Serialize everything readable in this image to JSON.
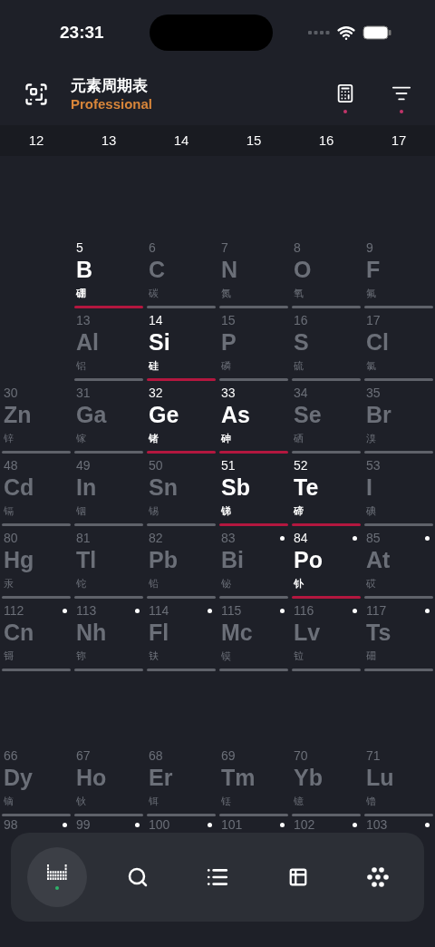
{
  "status_bar": {
    "time": "23:31"
  },
  "header": {
    "title": "元素周期表",
    "subtitle": "Professional"
  },
  "groups": [
    "12",
    "13",
    "14",
    "15",
    "16",
    "17"
  ],
  "rows": [
    {
      "cells": [
        {
          "kind": "empty"
        },
        {
          "kind": "element",
          "number": "5",
          "symbol": "B",
          "name": "硼",
          "highlighted": true,
          "radioactive": false
        },
        {
          "kind": "element",
          "number": "6",
          "symbol": "C",
          "name": "碳",
          "highlighted": false,
          "radioactive": false
        },
        {
          "kind": "element",
          "number": "7",
          "symbol": "N",
          "name": "氮",
          "highlighted": false,
          "radioactive": false
        },
        {
          "kind": "element",
          "number": "8",
          "symbol": "O",
          "name": "氧",
          "highlighted": false,
          "radioactive": false
        },
        {
          "kind": "element",
          "number": "9",
          "symbol": "F",
          "name": "氟",
          "highlighted": false,
          "radioactive": false
        }
      ]
    },
    {
      "cells": [
        {
          "kind": "empty"
        },
        {
          "kind": "element",
          "number": "13",
          "symbol": "Al",
          "name": "铝",
          "highlighted": false,
          "radioactive": false
        },
        {
          "kind": "element",
          "number": "14",
          "symbol": "Si",
          "name": "硅",
          "highlighted": true,
          "radioactive": false
        },
        {
          "kind": "element",
          "number": "15",
          "symbol": "P",
          "name": "磷",
          "highlighted": false,
          "radioactive": false
        },
        {
          "kind": "element",
          "number": "16",
          "symbol": "S",
          "name": "硫",
          "highlighted": false,
          "radioactive": false
        },
        {
          "kind": "element",
          "number": "17",
          "symbol": "Cl",
          "name": "氯",
          "highlighted": false,
          "radioactive": false
        }
      ]
    },
    {
      "cells": [
        {
          "kind": "element",
          "number": "30",
          "symbol": "Zn",
          "name": "锌",
          "highlighted": false,
          "radioactive": false
        },
        {
          "kind": "element",
          "number": "31",
          "symbol": "Ga",
          "name": "镓",
          "highlighted": false,
          "radioactive": false
        },
        {
          "kind": "element",
          "number": "32",
          "symbol": "Ge",
          "name": "锗",
          "highlighted": true,
          "radioactive": false
        },
        {
          "kind": "element",
          "number": "33",
          "symbol": "As",
          "name": "砷",
          "highlighted": true,
          "radioactive": false
        },
        {
          "kind": "element",
          "number": "34",
          "symbol": "Se",
          "name": "硒",
          "highlighted": false,
          "radioactive": false
        },
        {
          "kind": "element",
          "number": "35",
          "symbol": "Br",
          "name": "溴",
          "highlighted": false,
          "radioactive": false
        }
      ]
    },
    {
      "cells": [
        {
          "kind": "element",
          "number": "48",
          "symbol": "Cd",
          "name": "镉",
          "highlighted": false,
          "radioactive": false
        },
        {
          "kind": "element",
          "number": "49",
          "symbol": "In",
          "name": "铟",
          "highlighted": false,
          "radioactive": false
        },
        {
          "kind": "element",
          "number": "50",
          "symbol": "Sn",
          "name": "锡",
          "highlighted": false,
          "radioactive": false
        },
        {
          "kind": "element",
          "number": "51",
          "symbol": "Sb",
          "name": "锑",
          "highlighted": true,
          "radioactive": false
        },
        {
          "kind": "element",
          "number": "52",
          "symbol": "Te",
          "name": "碲",
          "highlighted": true,
          "radioactive": false
        },
        {
          "kind": "element",
          "number": "53",
          "symbol": "I",
          "name": "碘",
          "highlighted": false,
          "radioactive": false
        }
      ]
    },
    {
      "cells": [
        {
          "kind": "element",
          "number": "80",
          "symbol": "Hg",
          "name": "汞",
          "highlighted": false,
          "radioactive": false
        },
        {
          "kind": "element",
          "number": "81",
          "symbol": "Tl",
          "name": "铊",
          "highlighted": false,
          "radioactive": false
        },
        {
          "kind": "element",
          "number": "82",
          "symbol": "Pb",
          "name": "铅",
          "highlighted": false,
          "radioactive": false
        },
        {
          "kind": "element",
          "number": "83",
          "symbol": "Bi",
          "name": "铋",
          "highlighted": false,
          "radioactive": true
        },
        {
          "kind": "element",
          "number": "84",
          "symbol": "Po",
          "name": "钋",
          "highlighted": true,
          "radioactive": true
        },
        {
          "kind": "element",
          "number": "85",
          "symbol": "At",
          "name": "砹",
          "highlighted": false,
          "radioactive": true
        }
      ]
    },
    {
      "cells": [
        {
          "kind": "element",
          "number": "112",
          "symbol": "Cn",
          "name": "鿔",
          "highlighted": false,
          "radioactive": true
        },
        {
          "kind": "element",
          "number": "113",
          "symbol": "Nh",
          "name": "鿭",
          "highlighted": false,
          "radioactive": true
        },
        {
          "kind": "element",
          "number": "114",
          "symbol": "Fl",
          "name": "𫓧",
          "highlighted": false,
          "radioactive": true
        },
        {
          "kind": "element",
          "number": "115",
          "symbol": "Mc",
          "name": "镆",
          "highlighted": false,
          "radioactive": true
        },
        {
          "kind": "element",
          "number": "116",
          "symbol": "Lv",
          "name": "𫟷",
          "highlighted": false,
          "radioactive": true
        },
        {
          "kind": "element",
          "number": "117",
          "symbol": "Ts",
          "name": "鿬",
          "highlighted": false,
          "radioactive": true
        }
      ]
    }
  ],
  "f_block": [
    {
      "cells": [
        {
          "kind": "element",
          "number": "66",
          "symbol": "Dy",
          "name": "镝",
          "highlighted": false,
          "radioactive": false
        },
        {
          "kind": "element",
          "number": "67",
          "symbol": "Ho",
          "name": "钬",
          "highlighted": false,
          "radioactive": false
        },
        {
          "kind": "element",
          "number": "68",
          "symbol": "Er",
          "name": "铒",
          "highlighted": false,
          "radioactive": false
        },
        {
          "kind": "element",
          "number": "69",
          "symbol": "Tm",
          "name": "铥",
          "highlighted": false,
          "radioactive": false
        },
        {
          "kind": "element",
          "number": "70",
          "symbol": "Yb",
          "name": "镱",
          "highlighted": false,
          "radioactive": false
        },
        {
          "kind": "element",
          "number": "71",
          "symbol": "Lu",
          "name": "镥",
          "highlighted": false,
          "radioactive": false
        }
      ]
    },
    {
      "cells": [
        {
          "kind": "partial",
          "number": "98",
          "radioactive": true
        },
        {
          "kind": "partial",
          "number": "99",
          "radioactive": true
        },
        {
          "kind": "partial",
          "number": "100",
          "radioactive": true
        },
        {
          "kind": "partial",
          "number": "101",
          "radioactive": true
        },
        {
          "kind": "partial",
          "number": "102",
          "radioactive": true
        },
        {
          "kind": "partial",
          "number": "103",
          "radioactive": true
        }
      ]
    }
  ],
  "tab_bar": [
    {
      "kind": "table",
      "selected": true
    },
    {
      "kind": "search",
      "selected": false
    },
    {
      "kind": "list",
      "selected": false
    },
    {
      "kind": "grid",
      "selected": false
    },
    {
      "kind": "dots",
      "selected": false
    }
  ]
}
